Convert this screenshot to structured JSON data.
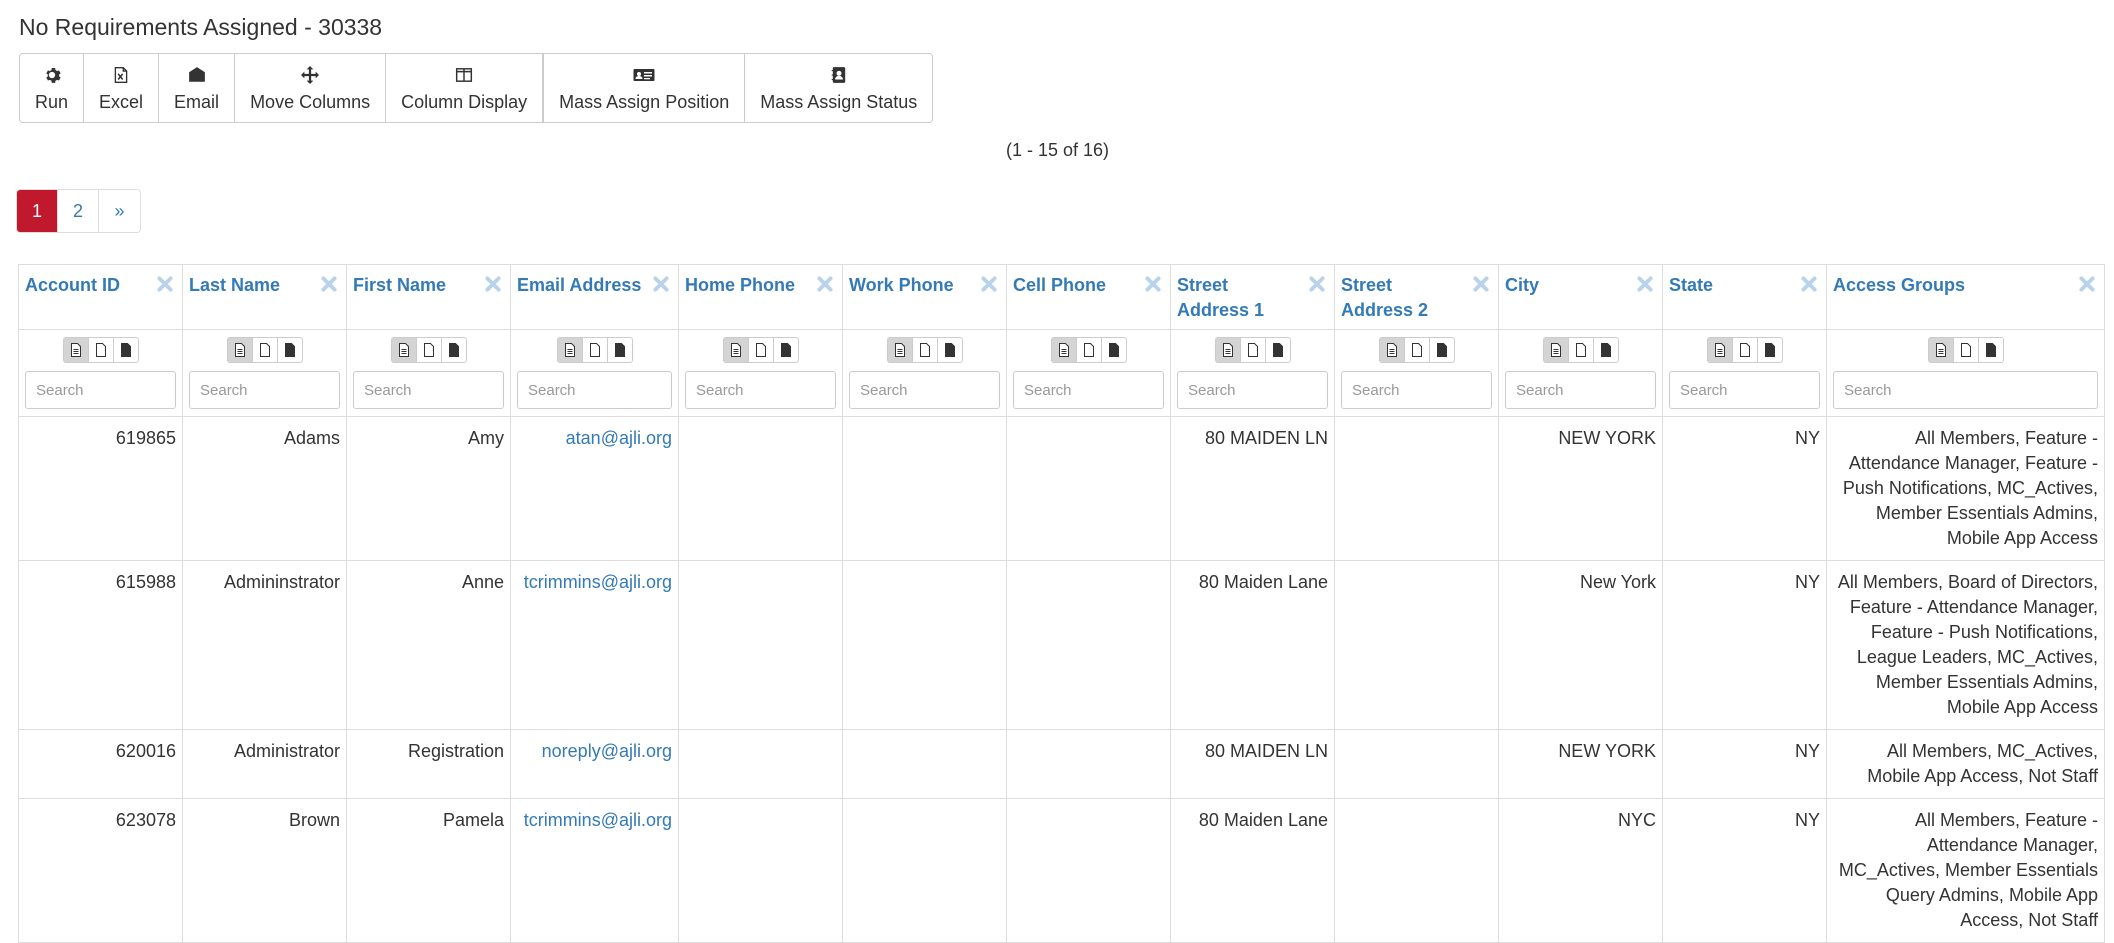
{
  "page": {
    "title": "No Requirements Assigned - 30338"
  },
  "toolbar": [
    {
      "label": "Run",
      "icon": "gear-icon"
    },
    {
      "label": "Excel",
      "icon": "excel-file-icon"
    },
    {
      "label": "Email",
      "icon": "envelope-icon"
    },
    {
      "label": "Move Columns",
      "icon": "move-arrows-icon"
    },
    {
      "label": "Column Display",
      "icon": "columns-icon"
    },
    {
      "label": "Mass Assign Position",
      "icon": "id-card-icon"
    },
    {
      "label": "Mass Assign Status",
      "icon": "contact-book-icon"
    }
  ],
  "pagination": {
    "range_text": "(1 - 15 of 16)",
    "pages": [
      "1",
      "2",
      "»"
    ],
    "active": "1"
  },
  "grid": {
    "search_placeholder": "Search",
    "columns": [
      "Account ID",
      "Last Name",
      "First Name",
      "Email Address",
      "Home Phone",
      "Work Phone",
      "Cell Phone",
      "Street Address 1",
      "Street Address 2",
      "City",
      "State",
      "Access Groups"
    ],
    "rows": [
      [
        "619865",
        "Adams",
        "Amy",
        "atan@ajli.org",
        "",
        "",
        "",
        "80 MAIDEN LN",
        "",
        "NEW YORK",
        "NY",
        "All Members, Feature - Attendance Manager, Feature - Push Notifications, MC_Actives, Member Essentials Admins, Mobile App Access"
      ],
      [
        "615988",
        "Admininstrator",
        "Anne",
        "tcrimmins@ajli.org",
        "",
        "",
        "",
        "80 Maiden Lane",
        "",
        "New York",
        "NY",
        "All Members, Board of Directors, Feature - Attendance Manager, Feature - Push Notifications, League Leaders, MC_Actives, Member Essentials Admins, Mobile App Access"
      ],
      [
        "620016",
        "Administrator",
        "Registration",
        "noreply@ajli.org",
        "",
        "",
        "",
        "80 MAIDEN LN",
        "",
        "NEW YORK",
        "NY",
        "All Members, MC_Actives, Mobile App Access, Not Staff"
      ],
      [
        "623078",
        "Brown",
        "Pamela",
        "tcrimmins@ajli.org",
        "",
        "",
        "",
        "80 Maiden Lane",
        "",
        "NYC",
        "NY",
        "All Members, Feature - Attendance Manager, MC_Actives, Member Essentials Query Admins, Mobile App Access, Not Staff"
      ]
    ]
  }
}
